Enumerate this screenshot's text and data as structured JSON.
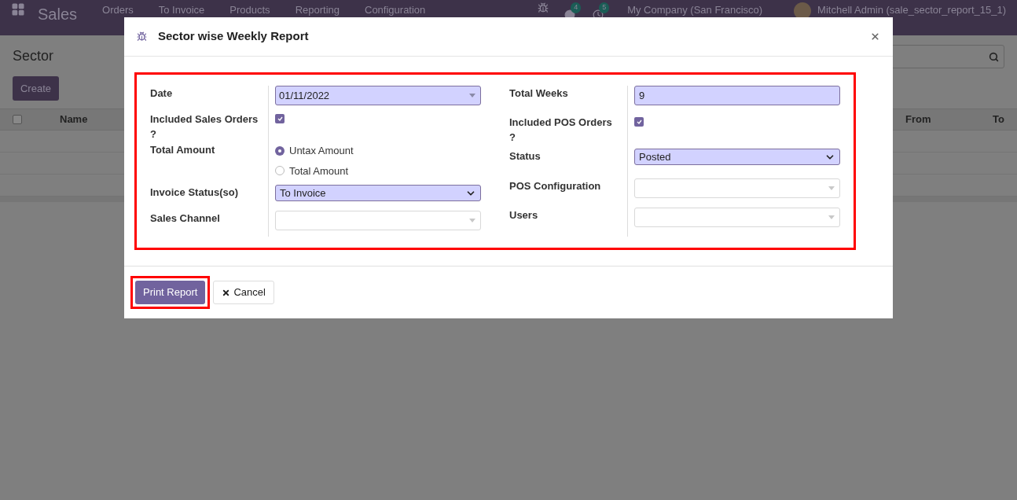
{
  "navbar": {
    "app": "Sales",
    "menu": [
      "Orders",
      "To Invoice",
      "Products",
      "Reporting",
      "Configuration"
    ],
    "chat_count": "4",
    "activity_count": "5",
    "company": "My Company (San Francisco)",
    "user": "Mitchell Admin (sale_sector_report_15_1)"
  },
  "page": {
    "title": "Sector",
    "create": "Create",
    "all_selected": false,
    "columns": [
      "Name",
      "From",
      "To"
    ]
  },
  "dialog": {
    "title": "Sector wise Weekly Report",
    "form_highlighted": true,
    "left_fields": [
      {
        "label": "Date",
        "kind": "dropdown",
        "value": "01/11/2022",
        "required": true
      },
      {
        "label": "Included Sales Orders ?",
        "kind": "checkbox",
        "checked": true
      },
      {
        "label": "Total Amount",
        "kind": "radio",
        "options": [
          {
            "label": "Untax Amount",
            "selected": true
          },
          {
            "label": "Total Amount",
            "selected": false
          }
        ]
      },
      {
        "label": "Invoice Status(so)",
        "kind": "select",
        "value": "To Invoice",
        "required": true
      },
      {
        "label": "Sales Channel",
        "kind": "dropdown",
        "required": false
      }
    ],
    "right_fields": [
      {
        "label": "Total Weeks",
        "kind": "text",
        "value": "9",
        "required": true
      },
      {
        "label": "Included POS Orders ?",
        "kind": "checkbox",
        "checked": true
      },
      {
        "label": "Status",
        "kind": "select",
        "value": "Posted",
        "required": true
      },
      {
        "label": "POS Configuration",
        "kind": "dropdown",
        "required": false
      },
      {
        "label": "Users",
        "kind": "dropdown",
        "required": false
      }
    ],
    "buttons": [
      {
        "label": "Print Report",
        "kind": "primary",
        "highlighted": true
      },
      {
        "label": "Cancel",
        "kind": "secondary",
        "highlighted": false
      }
    ]
  }
}
